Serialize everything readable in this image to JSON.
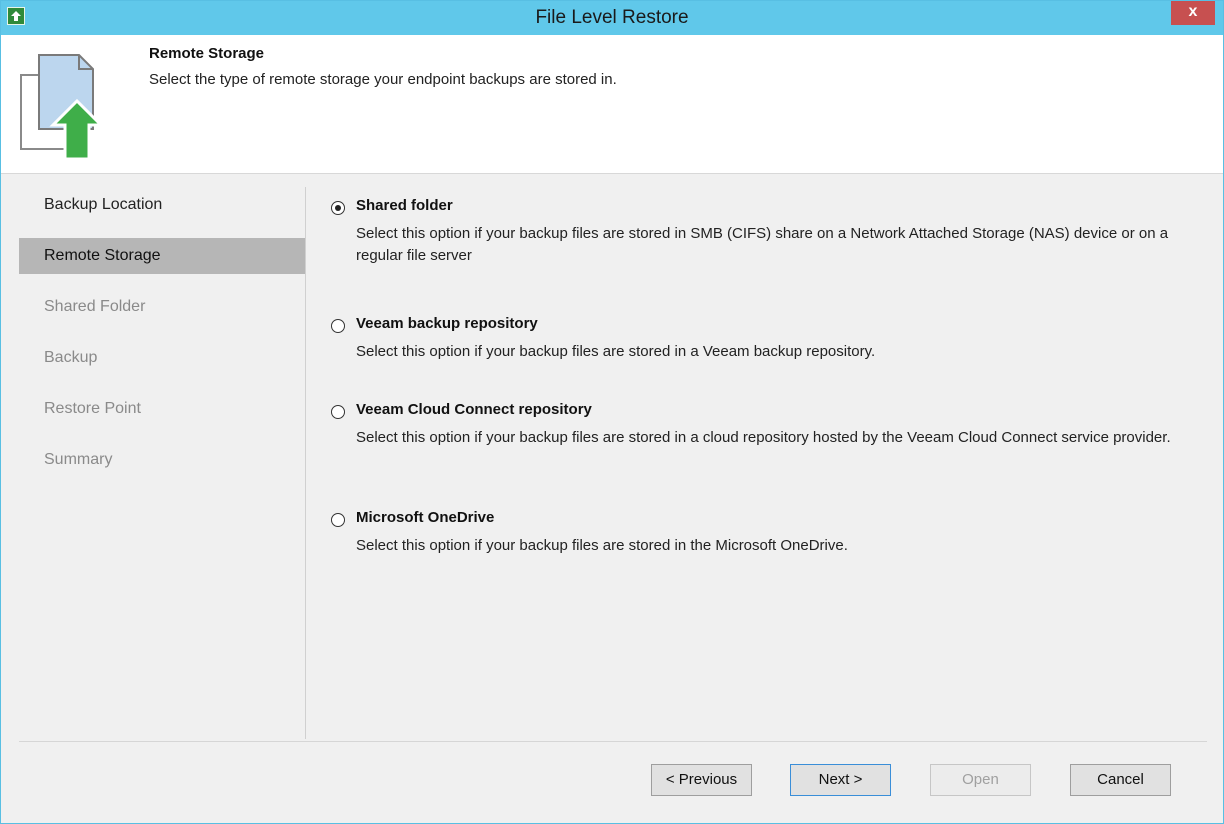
{
  "window": {
    "title": "File Level Restore",
    "close_label": "x"
  },
  "header": {
    "title": "Remote Storage",
    "description": "Select the type of remote storage your endpoint backups are stored in."
  },
  "sidebar": {
    "items": [
      {
        "label": "Backup Location",
        "state": "done"
      },
      {
        "label": "Remote Storage",
        "state": "active"
      },
      {
        "label": "Shared Folder",
        "state": "pending"
      },
      {
        "label": "Backup",
        "state": "pending"
      },
      {
        "label": "Restore Point",
        "state": "pending"
      },
      {
        "label": "Summary",
        "state": "pending"
      }
    ]
  },
  "options": [
    {
      "label": "Shared folder",
      "selected": true,
      "description": "Select this option if your backup files are stored in SMB (CIFS) share on a Network Attached Storage (NAS) device or on a regular file server"
    },
    {
      "label": "Veeam backup repository",
      "selected": false,
      "description": "Select this option if your backup files are stored in a Veeam backup repository."
    },
    {
      "label": "Veeam Cloud Connect repository",
      "selected": false,
      "description": "Select this option if your backup files are stored in a cloud repository hosted by the Veeam Cloud Connect service provider."
    },
    {
      "label": "Microsoft OneDrive",
      "selected": false,
      "description": "Select this option if your backup files are stored in the Microsoft OneDrive."
    }
  ],
  "buttons": {
    "previous": "< Previous",
    "next": "Next >",
    "open": "Open",
    "cancel": "Cancel"
  },
  "colors": {
    "titlebar": "#60c8ea",
    "close": "#c75050",
    "arrow": "#3fae49"
  }
}
